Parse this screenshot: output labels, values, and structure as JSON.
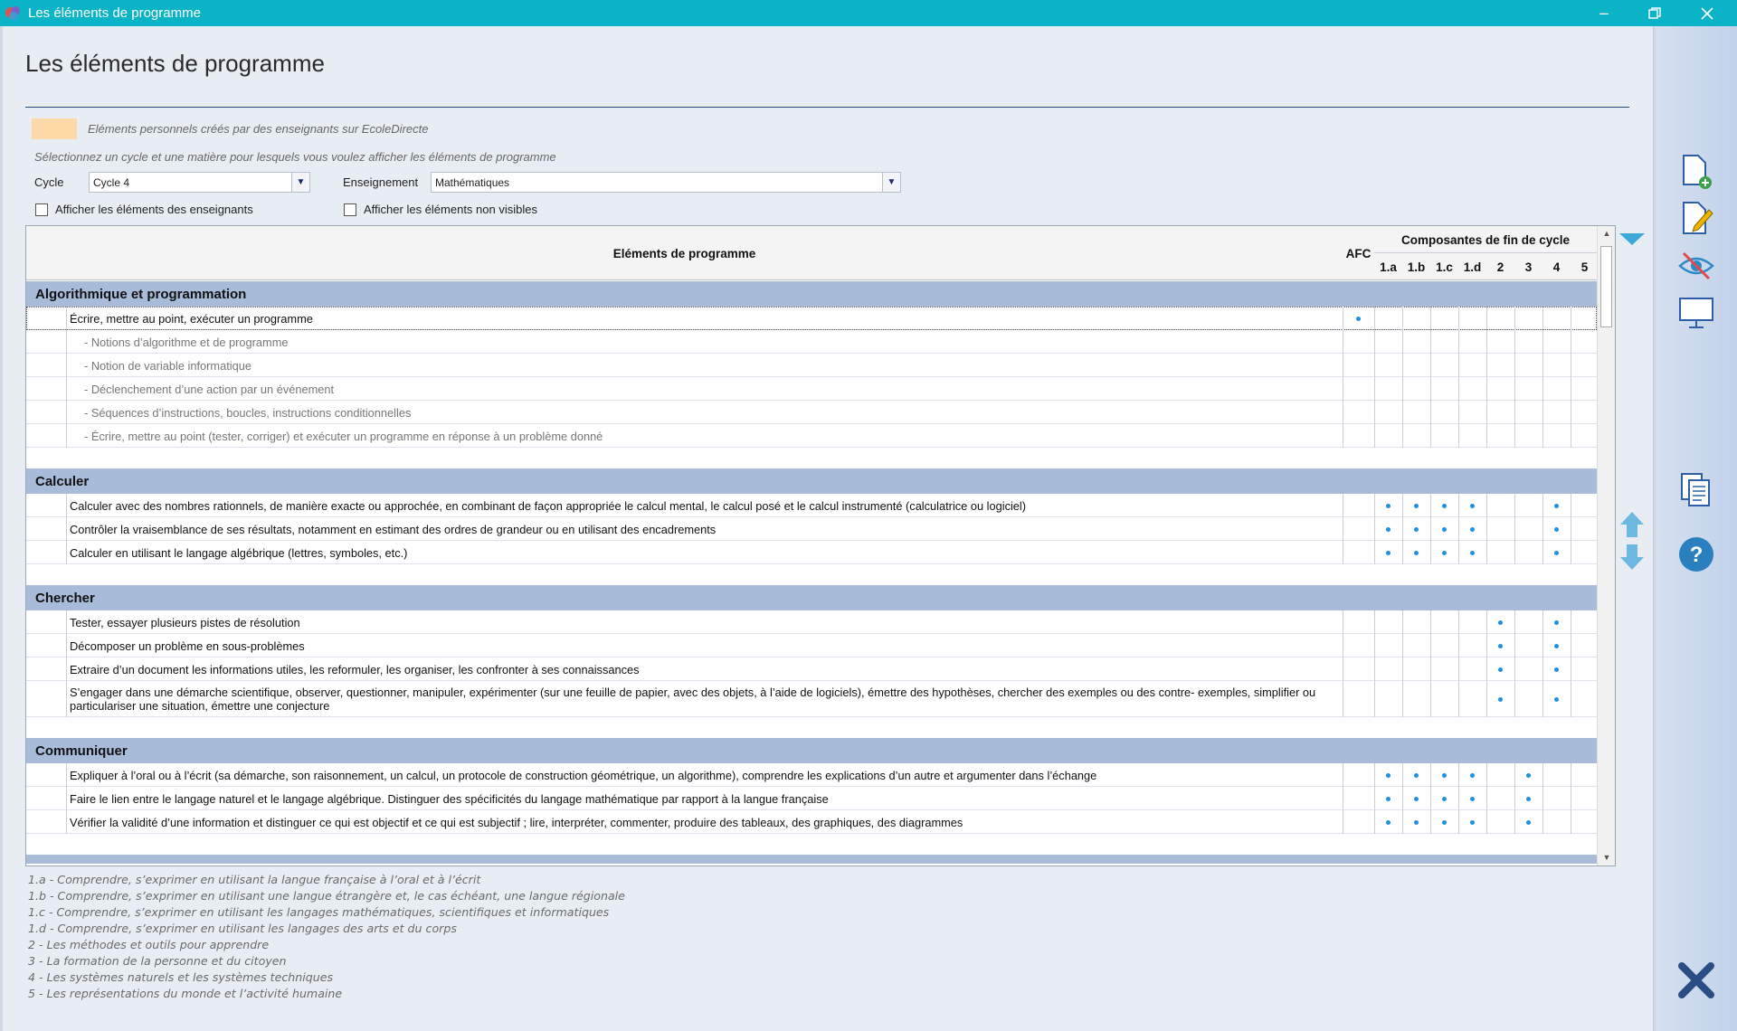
{
  "window": {
    "title": "Les éléments de programme"
  },
  "page": {
    "title": "Les éléments de programme",
    "legend_text": "Eléments personnels créés par des enseignants sur EcoleDirecte",
    "hint": "Sélectionnez un cycle et une matière pour lesquels vous voulez afficher les éléments de programme",
    "swatch_color": "#fcd9a6"
  },
  "filters": {
    "cycle_label": "Cycle",
    "cycle_value": "Cycle 4",
    "enseignement_label": "Enseignement",
    "enseignement_value": "Mathématiques",
    "show_teachers_label": "Afficher les éléments des enseignants",
    "show_hidden_label": "Afficher les éléments non visibles"
  },
  "table": {
    "header_elements": "Eléments de programme",
    "header_afc": "AFC",
    "header_composantes": "Composantes de fin de cycle",
    "columns": [
      "1.a",
      "1.b",
      "1.c",
      "1.d",
      "2",
      "3",
      "4",
      "5"
    ],
    "sections": [
      {
        "title": "Algorithmique et programmation",
        "rows": [
          {
            "text": "Écrire, mettre au point, exécuter un programme",
            "sub": false,
            "afc": true,
            "marks": []
          },
          {
            "text": "- Notions d’algorithme et de programme",
            "sub": true,
            "afc": false,
            "marks": []
          },
          {
            "text": "- Notion de variable informatique",
            "sub": true,
            "afc": false,
            "marks": []
          },
          {
            "text": "- Déclenchement d’une action par un événement",
            "sub": true,
            "afc": false,
            "marks": []
          },
          {
            "text": "- Séquences d’instructions, boucles, instructions conditionnelles",
            "sub": true,
            "afc": false,
            "marks": []
          },
          {
            "text": "- Écrire, mettre au point (tester, corriger) et exécuter un programme en réponse à un problème donné",
            "sub": true,
            "afc": false,
            "marks": []
          }
        ]
      },
      {
        "title": "Calculer",
        "rows": [
          {
            "text": "Calculer avec des nombres rationnels, de manière exacte ou approchée, en combinant de façon appropriée le calcul mental, le calcul posé et le calcul instrumenté (calculatrice ou logiciel)",
            "sub": false,
            "afc": false,
            "marks": [
              "1.a",
              "1.b",
              "1.c",
              "1.d",
              "4"
            ]
          },
          {
            "text": "Contrôler la vraisemblance de ses résultats, notamment en estimant des ordres de grandeur ou en utilisant des encadrements",
            "sub": false,
            "afc": false,
            "marks": [
              "1.a",
              "1.b",
              "1.c",
              "1.d",
              "4"
            ]
          },
          {
            "text": "Calculer en utilisant le langage algébrique (lettres, symboles, etc.)",
            "sub": false,
            "afc": false,
            "marks": [
              "1.a",
              "1.b",
              "1.c",
              "1.d",
              "4"
            ]
          }
        ]
      },
      {
        "title": "Chercher",
        "rows": [
          {
            "text": "Tester, essayer plusieurs pistes de résolution",
            "sub": false,
            "afc": false,
            "marks": [
              "2",
              "4"
            ]
          },
          {
            "text": "Décomposer un problème en sous-problèmes",
            "sub": false,
            "afc": false,
            "marks": [
              "2",
              "4"
            ]
          },
          {
            "text": "Extraire d’un document les informations utiles, les reformuler, les organiser, les confronter à ses connaissances",
            "sub": false,
            "afc": false,
            "marks": [
              "2",
              "4"
            ]
          },
          {
            "text": "S’engager dans une démarche scientifique, observer, questionner, manipuler, expérimenter (sur une feuille de papier, avec des objets, à l’aide de logiciels), émettre des hypothèses, chercher des exemples ou des contre- exemples, simplifier ou particulariser une situation, émettre une conjecture",
            "sub": false,
            "afc": false,
            "marks": [
              "2",
              "4"
            ]
          }
        ]
      },
      {
        "title": "Communiquer",
        "rows": [
          {
            "text": "Expliquer à l’oral ou à l’écrit (sa démarche, son raisonnement, un calcul, un protocole de construction géométrique, un  algorithme), comprendre les explications d’un autre et  argumenter dans l’échange",
            "sub": false,
            "afc": false,
            "marks": [
              "1.a",
              "1.b",
              "1.c",
              "1.d",
              "3"
            ]
          },
          {
            "text": "Faire le lien entre le langage naturel et le langage algébrique. Distinguer des spécificités du langage mathématique par rapport à la langue française",
            "sub": false,
            "afc": false,
            "marks": [
              "1.a",
              "1.b",
              "1.c",
              "1.d",
              "3"
            ]
          },
          {
            "text": "Vérifier la validité d’une information et distinguer ce qui est objectif et ce qui est subjectif ; lire, interpréter, commenter, produire des tableaux, des graphiques, des diagrammes",
            "sub": false,
            "afc": false,
            "marks": [
              "1.a",
              "1.b",
              "1.c",
              "1.d",
              "3"
            ]
          }
        ]
      }
    ]
  },
  "notes": [
    "1.a - Comprendre, s’exprimer en utilisant la langue française à l’oral et à l’écrit",
    "1.b - Comprendre, s’exprimer en utilisant une langue étrangère et, le cas échéant, une langue régionale",
    "1.c - Comprendre, s’exprimer en utilisant les langages mathématiques, scientifiques et informatiques",
    "1.d - Comprendre, s’exprimer en utilisant les langages des arts et du corps",
    "2 - Les méthodes et outils pour apprendre",
    "3 - La formation de la personne et du citoyen",
    "4 - Les systèmes naturels et les systèmes techniques",
    "5 - Les représentations du monde et l’activité humaine"
  ],
  "toolbar": {
    "icons": [
      "new-document-icon",
      "edit-icon",
      "hide-icon",
      "display-icon",
      "copy-icon",
      "help-icon",
      "close-icon"
    ]
  }
}
